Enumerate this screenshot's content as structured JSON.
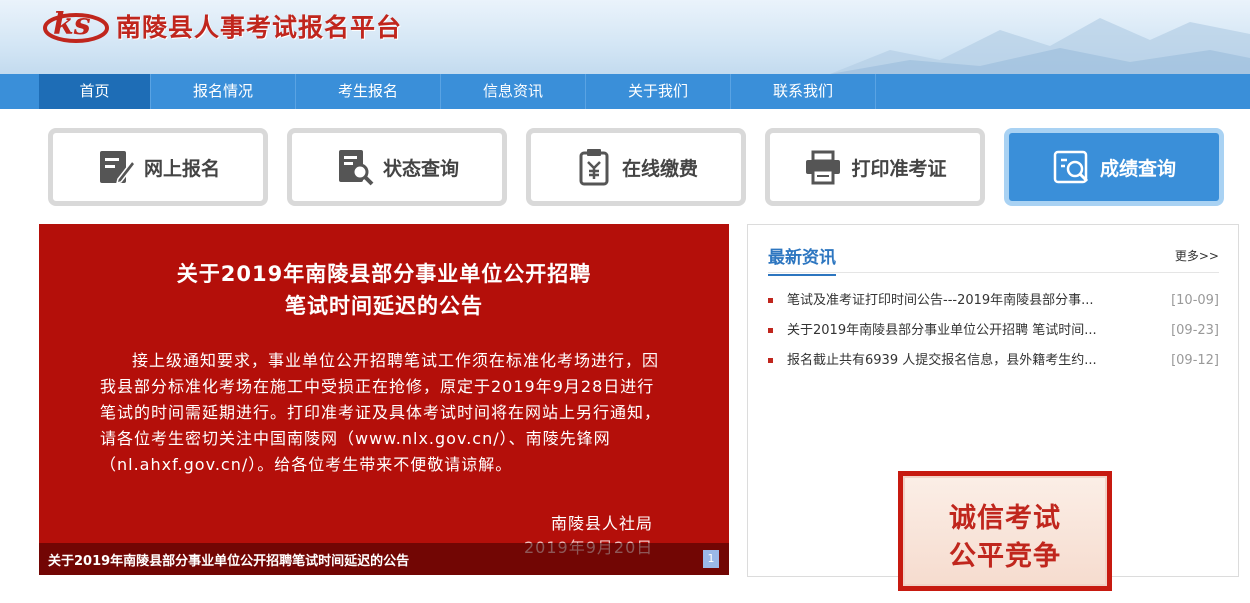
{
  "header": {
    "title": "南陵县人事考试报名平台",
    "logo_text": "ks"
  },
  "nav": {
    "items": [
      "首页",
      "报名情况",
      "考生报名",
      "信息资讯",
      "关于我们",
      "联系我们"
    ],
    "active_index": 0
  },
  "quick_links": [
    {
      "label": "网上报名",
      "icon": "register-form-icon"
    },
    {
      "label": "状态查询",
      "icon": "status-search-icon"
    },
    {
      "label": "在线缴费",
      "icon": "payment-icon"
    },
    {
      "label": "打印准考证",
      "icon": "printer-icon"
    },
    {
      "label": "成绩查询",
      "icon": "score-search-icon"
    }
  ],
  "notice": {
    "title_line1": "关于2019年南陵县部分事业单位公开招聘",
    "title_line2": "笔试时间延迟的公告",
    "body": "接上级通知要求，事业单位公开招聘笔试工作须在标准化考场进行，因我县部分标准化考场在施工中受损正在抢修，原定于2019年9月28日进行笔试的时间需延期进行。打印准考证及具体考试时间将在网站上另行通知，请各位考生密切关注中国南陵网（www.nlx.gov.cn/）、南陵先锋网（nl.ahxf.gov.cn/）。给各位考生带来不便敬请谅解。",
    "org": "南陵县人社局",
    "date": "2019年9月20日",
    "caption": "关于2019年南陵县部分事业单位公开招聘笔试时间延迟的公告",
    "page": "1"
  },
  "news": {
    "title": "最新资讯",
    "more": "更多>>",
    "items": [
      {
        "text": "笔试及准考证打印时间公告---2019年南陵县部分事...",
        "date": "[10-09]"
      },
      {
        "text": "关于2019年南陵县部分事业单位公开招聘 笔试时间...",
        "date": "[09-23]"
      },
      {
        "text": "报名截止共有6939 人提交报名信息，县外籍考生约...",
        "date": "[09-12]"
      }
    ]
  },
  "banner": {
    "line1": "诚信考试",
    "line2": "公平竞争"
  },
  "colors": {
    "brand_red": "#c0261d",
    "nav_blue": "#3a8fd9",
    "nav_active": "#1e6db6",
    "notice_bg": "#b40f0a"
  }
}
